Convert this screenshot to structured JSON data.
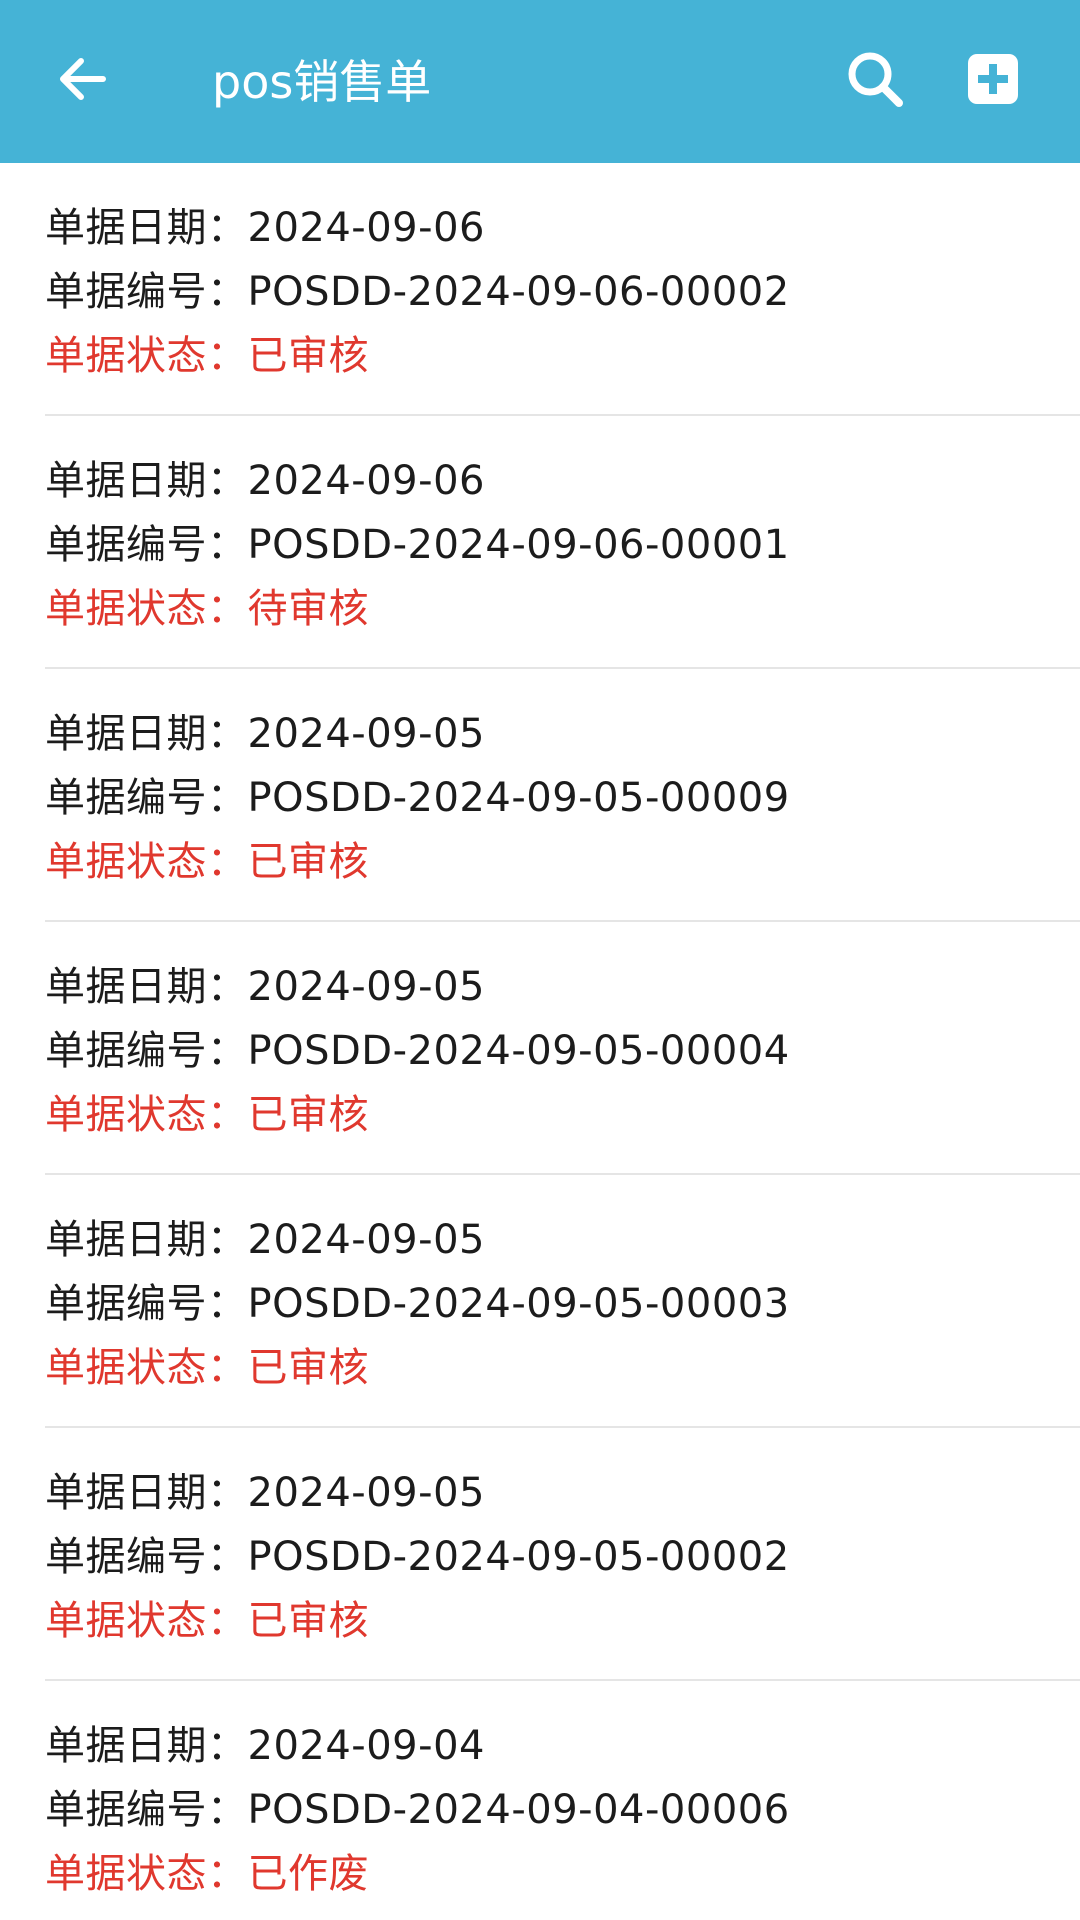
{
  "header": {
    "title": "pos销售单",
    "back_icon": "arrow-left-icon",
    "search_icon": "search-icon",
    "add_icon": "plus-square-icon",
    "background_color": "#45b3d6"
  },
  "labels": {
    "date": "单据日期：",
    "number": "单据编号：",
    "status": "单据状态："
  },
  "colors": {
    "status_text": "#e0382e",
    "primary_text": "#1c1c1c",
    "divider": "#e5e5e5"
  },
  "records": [
    {
      "date": "2024-09-06",
      "number": "POSDD-2024-09-06-00002",
      "status": "已审核"
    },
    {
      "date": "2024-09-06",
      "number": "POSDD-2024-09-06-00001",
      "status": "待审核"
    },
    {
      "date": "2024-09-05",
      "number": "POSDD-2024-09-05-00009",
      "status": "已审核"
    },
    {
      "date": "2024-09-05",
      "number": "POSDD-2024-09-05-00004",
      "status": "已审核"
    },
    {
      "date": "2024-09-05",
      "number": "POSDD-2024-09-05-00003",
      "status": "已审核"
    },
    {
      "date": "2024-09-05",
      "number": "POSDD-2024-09-05-00002",
      "status": "已审核"
    },
    {
      "date": "2024-09-04",
      "number": "POSDD-2024-09-04-00006",
      "status": "已作废"
    }
  ]
}
